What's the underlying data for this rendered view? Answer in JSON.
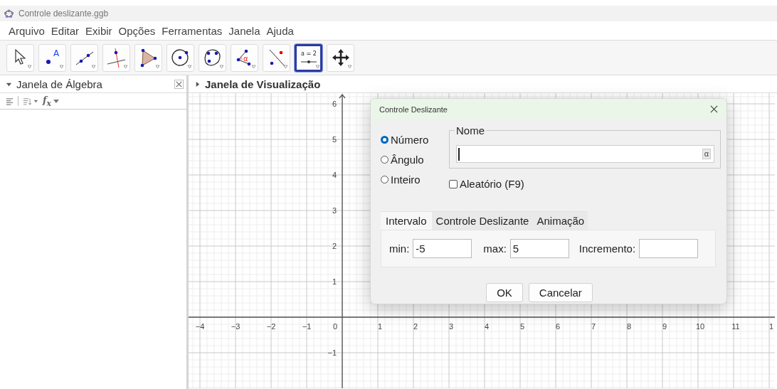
{
  "window": {
    "title": "Controle deslizante.ggb"
  },
  "menu": [
    "Arquivo",
    "Editar",
    "Exibir",
    "Opções",
    "Ferramentas",
    "Janela",
    "Ajuda"
  ],
  "tools": [
    {
      "kind": "move",
      "selected": false
    },
    {
      "kind": "point",
      "selected": false,
      "label": "A"
    },
    {
      "kind": "line",
      "selected": false
    },
    {
      "kind": "perpendicular",
      "selected": false
    },
    {
      "kind": "polygon",
      "selected": false
    },
    {
      "kind": "circle",
      "selected": false
    },
    {
      "kind": "conic",
      "selected": false
    },
    {
      "kind": "angle",
      "selected": false,
      "label": "α"
    },
    {
      "kind": "reflect",
      "selected": false
    },
    {
      "kind": "slider",
      "selected": true,
      "label": "a = 2"
    },
    {
      "kind": "pan",
      "selected": false
    }
  ],
  "algebra_view": {
    "title": "Janela de Álgebra",
    "input_label": "f$_{x}$"
  },
  "graphics_view": {
    "title": "Janela de Visualização",
    "x_negative_labels": [
      "−4",
      "−3",
      "−2",
      "−1"
    ],
    "x_positive_labels": [
      "1",
      "2",
      "3",
      "4",
      "5",
      "6",
      "7",
      "8",
      "9",
      "10",
      "11",
      "1"
    ],
    "origin_label": "0",
    "y_positive_labels": [
      "6",
      "5",
      "4",
      "3",
      "2",
      "1"
    ],
    "y_negative_labels": [
      "−1"
    ]
  },
  "dialog": {
    "title": "Controle Deslizante",
    "types": [
      {
        "label": "Número",
        "selected": true
      },
      {
        "label": "Ângulo",
        "selected": false
      },
      {
        "label": "Inteiro",
        "selected": false
      }
    ],
    "name_label": "Nome",
    "symbol_button": "α",
    "random": {
      "label": "Aleatório (F9)",
      "checked": false
    },
    "tabs": [
      {
        "label": "Intervalo",
        "selected": true
      },
      {
        "label": "Controle Deslizante",
        "selected": false
      },
      {
        "label": "Animação",
        "selected": false
      }
    ],
    "fields": [
      {
        "label": "min:",
        "value": "-5"
      },
      {
        "label": "max:",
        "value": "5"
      },
      {
        "label": "Incremento:"
      }
    ],
    "buttons": [
      "OK",
      "Cancelar"
    ]
  }
}
